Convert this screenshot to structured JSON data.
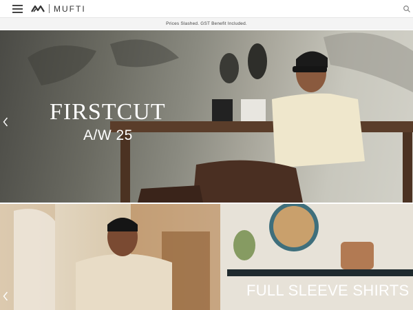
{
  "header": {
    "menu_icon": "hamburger-icon",
    "logo_icon": "mufti-mark-icon",
    "brand": "MUFTI",
    "search_icon": "search-icon"
  },
  "promo": {
    "text": "Prices Slashed. GST Benefit Included."
  },
  "banners": [
    {
      "headline": "FIRSTCUT",
      "subheadline": "A/W 25",
      "arrow_icon": "chevron-left-icon"
    },
    {
      "headline": "FULL SLEEVE SHIRTS",
      "arrow_icon": "chevron-left-icon"
    }
  ],
  "colors": {
    "header_bg": "#ffffff",
    "promo_bg": "#f4f4f4",
    "headline_text": "#ffffff",
    "brand_text": "#333333"
  }
}
